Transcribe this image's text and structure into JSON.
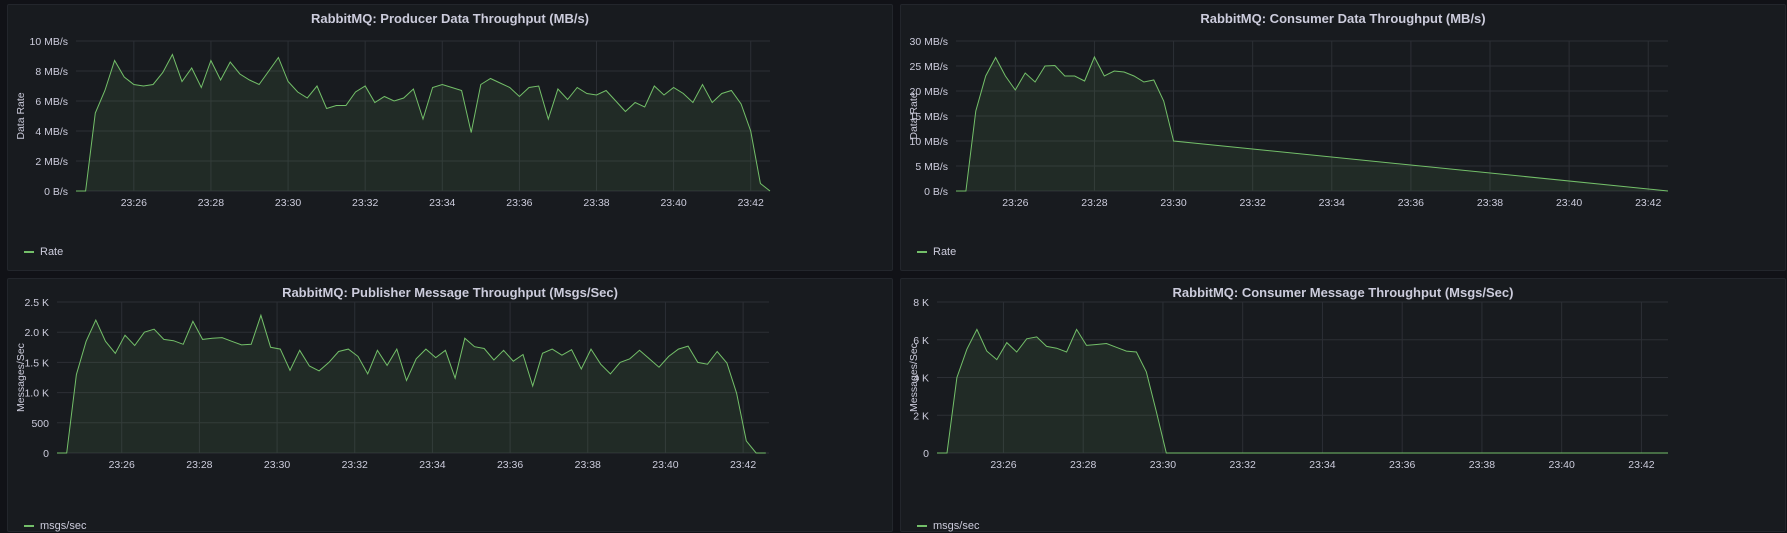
{
  "colors": {
    "series": "#73bf69",
    "grid": "#2c2f35",
    "background": "#181b1f",
    "page": "#111217"
  },
  "panels": [
    {
      "title": "RabbitMQ: Producer Data Throughput (MB/s)",
      "legend": "Rate",
      "chart_data": {
        "type": "area",
        "title": "RabbitMQ: Producer Data Throughput (MB/s)",
        "ylabel": "Data Rate",
        "xlabel": "",
        "xlim": [
          "23:24:30",
          "23:42:30"
        ],
        "ylim": [
          0,
          10
        ],
        "yticks": [
          0,
          2,
          4,
          6,
          8,
          10
        ],
        "ytick_labels": [
          "0 B/s",
          "2 MB/s",
          "4 MB/s",
          "6 MB/s",
          "8 MB/s",
          "10 MB/s"
        ],
        "xtick_labels": [
          "23:26",
          "23:28",
          "23:30",
          "23:32",
          "23:34",
          "23:36",
          "23:38",
          "23:40",
          "23:42"
        ],
        "grid": true,
        "legend_position": "bottom-left",
        "series": [
          {
            "name": "Rate",
            "x": [
              "23:24:30",
              "23:24:45",
              "23:25:00",
              "23:25:15",
              "23:25:30",
              "23:25:45",
              "23:26:00",
              "23:26:15",
              "23:26:30",
              "23:26:45",
              "23:27:00",
              "23:27:15",
              "23:27:30",
              "23:27:45",
              "23:28:00",
              "23:28:15",
              "23:28:30",
              "23:28:45",
              "23:29:00",
              "23:29:15",
              "23:29:30",
              "23:29:45",
              "23:30:00",
              "23:30:15",
              "23:30:30",
              "23:30:45",
              "23:31:00",
              "23:31:15",
              "23:31:30",
              "23:31:45",
              "23:32:00",
              "23:32:15",
              "23:32:30",
              "23:32:45",
              "23:33:00",
              "23:33:15",
              "23:33:30",
              "23:33:45",
              "23:34:00",
              "23:34:15",
              "23:34:30",
              "23:34:45",
              "23:35:00",
              "23:35:15",
              "23:35:30",
              "23:35:45",
              "23:36:00",
              "23:36:15",
              "23:36:30",
              "23:36:45",
              "23:37:00",
              "23:37:15",
              "23:37:30",
              "23:37:45",
              "23:38:00",
              "23:38:15",
              "23:38:30",
              "23:38:45",
              "23:39:00",
              "23:39:15",
              "23:39:30",
              "23:39:45",
              "23:40:00",
              "23:40:15",
              "23:40:30",
              "23:40:45",
              "23:41:00",
              "23:41:15",
              "23:41:30",
              "23:41:45",
              "23:42:00",
              "23:42:15",
              "23:42:30"
            ],
            "y": [
              0,
              0,
              5.2,
              6.7,
              8.7,
              7.6,
              7.1,
              7.0,
              7.1,
              7.9,
              9.1,
              7.3,
              8.2,
              6.9,
              8.7,
              7.4,
              8.6,
              7.8,
              7.4,
              7.1,
              8.0,
              8.9,
              7.3,
              6.6,
              6.2,
              7.0,
              5.5,
              5.7,
              5.7,
              6.6,
              7.0,
              5.9,
              6.3,
              6.0,
              6.2,
              6.8,
              4.8,
              6.9,
              7.1,
              6.9,
              6.7,
              3.9,
              7.1,
              7.5,
              7.2,
              6.9,
              6.3,
              6.9,
              7.0,
              4.8,
              6.8,
              6.1,
              6.9,
              6.5,
              6.4,
              6.7,
              6.0,
              5.3,
              5.9,
              5.6,
              7.0,
              6.4,
              6.9,
              6.5,
              5.9,
              7.1,
              5.9,
              6.5,
              6.7,
              5.8,
              4.0,
              0.5,
              0
            ]
          }
        ]
      }
    },
    {
      "title": "RabbitMQ: Consumer Data Throughput (MB/s)",
      "legend": "Rate",
      "chart_data": {
        "type": "area",
        "title": "RabbitMQ: Consumer Data Throughput (MB/s)",
        "ylabel": "Data Rate",
        "xlabel": "",
        "xlim": [
          "23:24:30",
          "23:42:30"
        ],
        "ylim": [
          0,
          30
        ],
        "yticks": [
          0,
          5,
          10,
          15,
          20,
          25,
          30
        ],
        "ytick_labels": [
          "0 B/s",
          "5 MB/s",
          "10 MB/s",
          "15 MB/s",
          "20 MB/s",
          "25 MB/s",
          "30 MB/s"
        ],
        "xtick_labels": [
          "23:26",
          "23:28",
          "23:30",
          "23:32",
          "23:34",
          "23:36",
          "23:38",
          "23:40",
          "23:42"
        ],
        "grid": true,
        "legend_position": "bottom-left",
        "series": [
          {
            "name": "Rate",
            "x": [
              "23:24:30",
              "23:24:45",
              "23:25:00",
              "23:25:15",
              "23:25:30",
              "23:25:45",
              "23:26:00",
              "23:26:15",
              "23:26:30",
              "23:26:45",
              "23:27:00",
              "23:27:15",
              "23:27:30",
              "23:27:45",
              "23:28:00",
              "23:28:15",
              "23:28:30",
              "23:28:45",
              "23:29:00",
              "23:29:15",
              "23:29:30",
              "23:29:45",
              "23:30:00",
              "23:42:30"
            ],
            "y": [
              0,
              0,
              16,
              23,
              26.7,
              23,
              20.2,
              23.6,
              21.8,
              25,
              25.1,
              23,
              23,
              22,
              26.8,
              23,
              24,
              23.8,
              23,
              21.8,
              22.2,
              18,
              10,
              0
            ]
          }
        ]
      }
    },
    {
      "title": "RabbitMQ: Publisher Message Throughput (Msgs/Sec)",
      "legend": "msgs/sec",
      "chart_data": {
        "type": "area",
        "title": "RabbitMQ: Publisher Message Throughput (Msgs/Sec)",
        "ylabel": "Messages/Sec",
        "xlabel": "",
        "xlim": [
          "23:24:20",
          "23:42:40"
        ],
        "ylim": [
          0,
          2500
        ],
        "yticks": [
          0,
          500,
          1000,
          1500,
          2000,
          2500
        ],
        "ytick_labels": [
          "0",
          "500",
          "1.0 K",
          "1.5 K",
          "2.0 K",
          "2.5 K"
        ],
        "xtick_labels": [
          "23:26",
          "23:28",
          "23:30",
          "23:32",
          "23:34",
          "23:36",
          "23:38",
          "23:40",
          "23:42"
        ],
        "grid": true,
        "legend_position": "bottom-left",
        "series": [
          {
            "name": "msgs/sec",
            "x": [
              "23:24:20",
              "23:24:35",
              "23:24:50",
              "23:25:05",
              "23:25:20",
              "23:25:35",
              "23:25:50",
              "23:26:05",
              "23:26:20",
              "23:26:35",
              "23:26:50",
              "23:27:05",
              "23:27:20",
              "23:27:35",
              "23:27:50",
              "23:28:05",
              "23:28:20",
              "23:28:35",
              "23:28:50",
              "23:29:05",
              "23:29:20",
              "23:29:35",
              "23:29:50",
              "23:30:05",
              "23:30:20",
              "23:30:35",
              "23:30:50",
              "23:31:05",
              "23:31:20",
              "23:31:35",
              "23:31:50",
              "23:32:05",
              "23:32:20",
              "23:32:35",
              "23:32:50",
              "23:33:05",
              "23:33:20",
              "23:33:35",
              "23:33:50",
              "23:34:05",
              "23:34:20",
              "23:34:35",
              "23:34:50",
              "23:35:05",
              "23:35:20",
              "23:35:35",
              "23:35:50",
              "23:36:05",
              "23:36:20",
              "23:36:35",
              "23:36:50",
              "23:37:05",
              "23:37:20",
              "23:37:35",
              "23:37:50",
              "23:38:05",
              "23:38:20",
              "23:38:35",
              "23:38:50",
              "23:39:05",
              "23:39:20",
              "23:39:35",
              "23:39:50",
              "23:40:05",
              "23:40:20",
              "23:40:35",
              "23:40:50",
              "23:41:05",
              "23:41:20",
              "23:41:35",
              "23:41:50",
              "23:42:05",
              "23:42:20",
              "23:42:35"
            ],
            "y": [
              0,
              0,
              1300,
              1850,
              2200,
              1850,
              1650,
              1950,
              1780,
              2000,
              2050,
              1880,
              1860,
              1800,
              2180,
              1880,
              1900,
              1910,
              1850,
              1790,
              1800,
              2280,
              1750,
              1720,
              1370,
              1700,
              1440,
              1360,
              1500,
              1680,
              1720,
              1600,
              1310,
              1700,
              1450,
              1720,
              1200,
              1560,
              1720,
              1580,
              1700,
              1240,
              1900,
              1760,
              1730,
              1540,
              1700,
              1520,
              1630,
              1110,
              1650,
              1720,
              1620,
              1710,
              1390,
              1720,
              1470,
              1310,
              1500,
              1560,
              1700,
              1560,
              1420,
              1600,
              1720,
              1770,
              1500,
              1470,
              1680,
              1490,
              990,
              200,
              0,
              0
            ]
          }
        ]
      }
    },
    {
      "title": "RabbitMQ: Consumer Message Throughput (Msgs/Sec)",
      "legend": "msgs/sec",
      "chart_data": {
        "type": "area",
        "title": "RabbitMQ: Consumer Message Throughput (Msgs/Sec)",
        "ylabel": "Messages/Sec",
        "xlabel": "",
        "xlim": [
          "23:24:20",
          "23:42:40"
        ],
        "ylim": [
          0,
          8000
        ],
        "yticks": [
          0,
          2000,
          4000,
          6000,
          8000
        ],
        "ytick_labels": [
          "0",
          "2 K",
          "4 K",
          "6 K",
          "8 K"
        ],
        "xtick_labels": [
          "23:26",
          "23:28",
          "23:30",
          "23:32",
          "23:34",
          "23:36",
          "23:38",
          "23:40",
          "23:42"
        ],
        "grid": true,
        "legend_position": "bottom-left",
        "series": [
          {
            "name": "msgs/sec",
            "x": [
              "23:24:20",
              "23:24:35",
              "23:24:50",
              "23:25:05",
              "23:25:20",
              "23:25:35",
              "23:25:50",
              "23:26:05",
              "23:26:20",
              "23:26:35",
              "23:26:50",
              "23:27:05",
              "23:27:20",
              "23:27:35",
              "23:27:50",
              "23:28:05",
              "23:28:20",
              "23:28:35",
              "23:28:50",
              "23:29:05",
              "23:29:20",
              "23:29:35",
              "23:29:50",
              "23:30:05",
              "23:42:40"
            ],
            "y": [
              0,
              0,
              4000,
              5500,
              6550,
              5400,
              4950,
              5850,
              5350,
              6050,
              6150,
              5650,
              5550,
              5350,
              6550,
              5700,
              5750,
              5800,
              5600,
              5400,
              5350,
              4300,
              2200,
              0,
              0
            ]
          }
        ]
      }
    }
  ]
}
